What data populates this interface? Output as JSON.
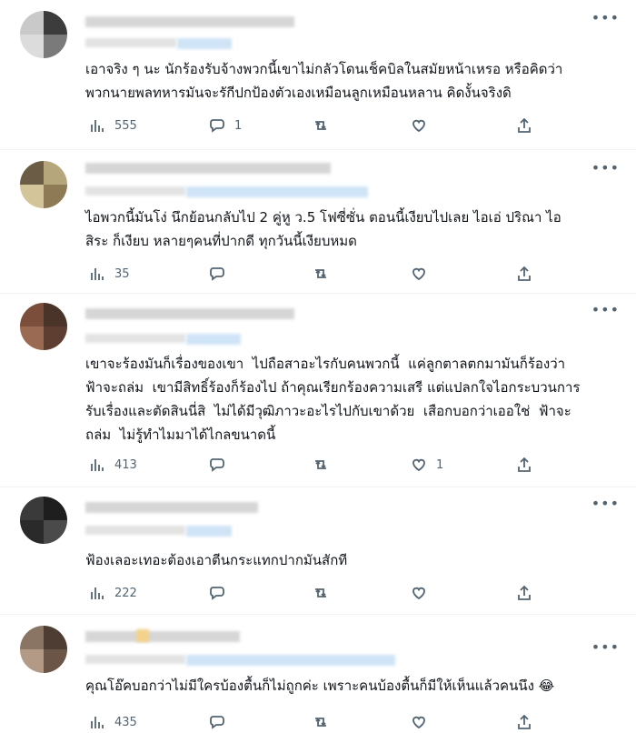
{
  "tweets": [
    {
      "text": "เอาจริง ๆ นะ นักร้องรับจ้างพวกนี้เขาไม่กลัวโดนเช็คบิลในสมัยหน้าเหรอ หรือคิดว่า\nพวกนายพลทหารมันจะรักีปกป้องตัวเองเหมือนลูกเหมือนหลาน คิดงั้นจริงดิ",
      "views": "555",
      "replies": "1",
      "retweets": "",
      "likes": ""
    },
    {
      "text": "ไอพวกนี้มันโง่ นึกย้อนกลับไป 2 คู่หู ว.5 โฟซี่ซั่น ตอนนี้เงียบไปเลย ไอเอ่ ปริณา ไอ\nสิระ ก็เงียบ หลายๆคนที่ปากดี ทุกวันนี้เงียบหมด",
      "views": "35",
      "replies": "",
      "retweets": "",
      "likes": ""
    },
    {
      "text": "เขาจะร้องมันก็เรื่องของเขา  ไปถือสาอะไรกับคนพวกนี้  แค่ลูกตาลตกมามันก็ร้องว่า\nฟ้าจะถล่ม  เขามีสิทธิ์ร้องก็ร้องไป ถ้าคุณเรียกร้องความเสรี แต่แปลกใจไอกระบวนการ\nรับเรื่องและตัดสินนี่สิ  ไม่ได้มีวุฒิภาวะอะไรไปกับเขาด้วย  เสือกบอกว่าเออใช่  ฟ้าจะ\nถล่ม  ไม่รู้ทำไมมาได้ไกลขนาดนี้",
      "views": "413",
      "replies": "",
      "retweets": "",
      "likes": "1"
    },
    {
      "text": "ฟ้องเลอะเทอะต้องเอาตีนกระแทกปากมันสักที",
      "views": "222",
      "replies": "",
      "retweets": "",
      "likes": ""
    },
    {
      "text": "คุณโอ๊คบอกว่าไม่มีใครบ้องตื้นก็ไม่ถูกค่ะ เพราะคนบ้องตื้นก็มีให้เห็นแล้วคนนึง 😂",
      "views": "435",
      "replies": "",
      "retweets": "",
      "likes": ""
    }
  ],
  "icons": {
    "views": "bar-chart-icon",
    "reply": "speech-bubble-icon",
    "retweet": "retweet-icon",
    "like": "heart-icon",
    "share": "share-icon",
    "more": "more-dots-icon"
  },
  "colors": {
    "text": "#0f1419",
    "secondary": "#536471",
    "divider": "#eff3f4"
  }
}
